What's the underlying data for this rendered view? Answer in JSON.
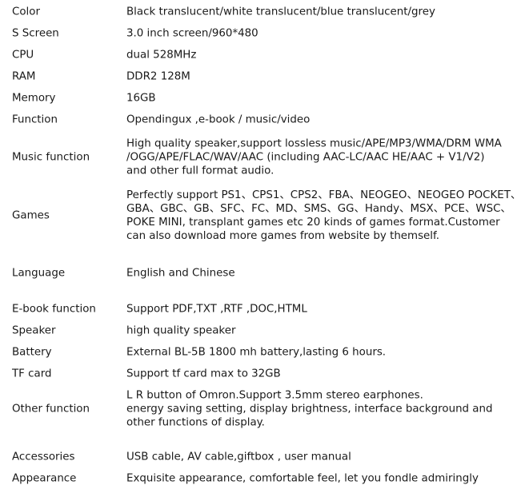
{
  "specs": [
    {
      "label": "Color",
      "value": "Black translucent/white translucent/blue translucent/grey"
    },
    {
      "label": "S Screen",
      "value": "3.0 inch screen/960*480"
    },
    {
      "label": "CPU",
      "value": "dual 528MHz"
    },
    {
      "label": "RAM",
      "value": "DDR2 128M"
    },
    {
      "label": "Memory",
      "value": "16GB"
    },
    {
      "label": "Function",
      "value": "Opendingux ,e-book / music/video"
    },
    {
      "label": "Music function",
      "value": "High quality speaker,support lossless music/APE/MP3/WMA/DRM WMA\n/OGG/APE/FLAC/WAV/AAC  (including AAC-LC/AAC HE/AAC + V1/V2)\nand other full  format audio."
    },
    {
      "label": "Games",
      "value": "Perfectly support PS1、CPS1、CPS2、FBA、NEOGEO、NEOGEO POCKET、\nGBA、GBC、GB、SFC、FC、MD、SMS、GG、Handy、MSX、PCE、WSC、\nPOKE MINI,  transplant games etc 20 kinds of games format.Customer\ncan also download more games from website by themself."
    },
    {
      "label": "Language",
      "value": "English and Chinese"
    },
    {
      "label": "E-book function",
      "value": "Support PDF,TXT ,RTF ,DOC,HTML"
    },
    {
      "label": "Speaker",
      "value": "high quality speaker"
    },
    {
      "label": "Battery",
      "value": "External BL-5B 1800 mh battery,lasting 6 hours."
    },
    {
      "label": "TF card",
      "value": "Support tf card max to 32GB"
    },
    {
      "label": "Other function",
      "value": " L R button of  Omron.Support 3.5mm stereo earphones.\nenergy saving setting, display brightness, interface background and\nother functions of display."
    },
    {
      "label": "Accessories",
      "value": "USB cable, AV cable,giftbox , user manual"
    },
    {
      "label": "Appearance",
      "value": "Exquisite appearance, comfortable feel, let you fondle admiringly"
    }
  ]
}
